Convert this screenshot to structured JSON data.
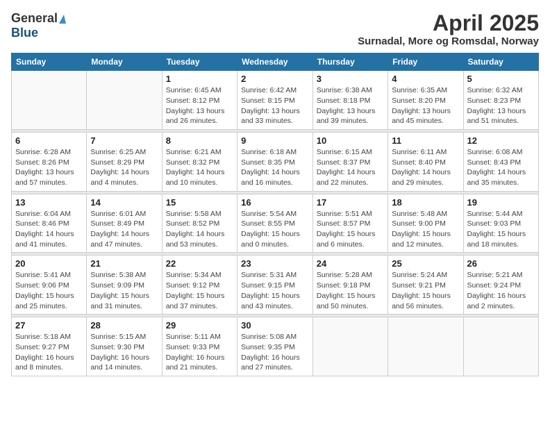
{
  "header": {
    "logo_general": "General",
    "logo_blue": "Blue",
    "month_title": "April 2025",
    "location": "Surnadal, More og Romsdal, Norway"
  },
  "weekdays": [
    "Sunday",
    "Monday",
    "Tuesday",
    "Wednesday",
    "Thursday",
    "Friday",
    "Saturday"
  ],
  "weeks": [
    [
      {
        "num": "",
        "info": ""
      },
      {
        "num": "",
        "info": ""
      },
      {
        "num": "1",
        "info": "Sunrise: 6:45 AM\nSunset: 8:12 PM\nDaylight: 13 hours and 26 minutes."
      },
      {
        "num": "2",
        "info": "Sunrise: 6:42 AM\nSunset: 8:15 PM\nDaylight: 13 hours and 33 minutes."
      },
      {
        "num": "3",
        "info": "Sunrise: 6:38 AM\nSunset: 8:18 PM\nDaylight: 13 hours and 39 minutes."
      },
      {
        "num": "4",
        "info": "Sunrise: 6:35 AM\nSunset: 8:20 PM\nDaylight: 13 hours and 45 minutes."
      },
      {
        "num": "5",
        "info": "Sunrise: 6:32 AM\nSunset: 8:23 PM\nDaylight: 13 hours and 51 minutes."
      }
    ],
    [
      {
        "num": "6",
        "info": "Sunrise: 6:28 AM\nSunset: 8:26 PM\nDaylight: 13 hours and 57 minutes."
      },
      {
        "num": "7",
        "info": "Sunrise: 6:25 AM\nSunset: 8:29 PM\nDaylight: 14 hours and 4 minutes."
      },
      {
        "num": "8",
        "info": "Sunrise: 6:21 AM\nSunset: 8:32 PM\nDaylight: 14 hours and 10 minutes."
      },
      {
        "num": "9",
        "info": "Sunrise: 6:18 AM\nSunset: 8:35 PM\nDaylight: 14 hours and 16 minutes."
      },
      {
        "num": "10",
        "info": "Sunrise: 6:15 AM\nSunset: 8:37 PM\nDaylight: 14 hours and 22 minutes."
      },
      {
        "num": "11",
        "info": "Sunrise: 6:11 AM\nSunset: 8:40 PM\nDaylight: 14 hours and 29 minutes."
      },
      {
        "num": "12",
        "info": "Sunrise: 6:08 AM\nSunset: 8:43 PM\nDaylight: 14 hours and 35 minutes."
      }
    ],
    [
      {
        "num": "13",
        "info": "Sunrise: 6:04 AM\nSunset: 8:46 PM\nDaylight: 14 hours and 41 minutes."
      },
      {
        "num": "14",
        "info": "Sunrise: 6:01 AM\nSunset: 8:49 PM\nDaylight: 14 hours and 47 minutes."
      },
      {
        "num": "15",
        "info": "Sunrise: 5:58 AM\nSunset: 8:52 PM\nDaylight: 14 hours and 53 minutes."
      },
      {
        "num": "16",
        "info": "Sunrise: 5:54 AM\nSunset: 8:55 PM\nDaylight: 15 hours and 0 minutes."
      },
      {
        "num": "17",
        "info": "Sunrise: 5:51 AM\nSunset: 8:57 PM\nDaylight: 15 hours and 6 minutes."
      },
      {
        "num": "18",
        "info": "Sunrise: 5:48 AM\nSunset: 9:00 PM\nDaylight: 15 hours and 12 minutes."
      },
      {
        "num": "19",
        "info": "Sunrise: 5:44 AM\nSunset: 9:03 PM\nDaylight: 15 hours and 18 minutes."
      }
    ],
    [
      {
        "num": "20",
        "info": "Sunrise: 5:41 AM\nSunset: 9:06 PM\nDaylight: 15 hours and 25 minutes."
      },
      {
        "num": "21",
        "info": "Sunrise: 5:38 AM\nSunset: 9:09 PM\nDaylight: 15 hours and 31 minutes."
      },
      {
        "num": "22",
        "info": "Sunrise: 5:34 AM\nSunset: 9:12 PM\nDaylight: 15 hours and 37 minutes."
      },
      {
        "num": "23",
        "info": "Sunrise: 5:31 AM\nSunset: 9:15 PM\nDaylight: 15 hours and 43 minutes."
      },
      {
        "num": "24",
        "info": "Sunrise: 5:28 AM\nSunset: 9:18 PM\nDaylight: 15 hours and 50 minutes."
      },
      {
        "num": "25",
        "info": "Sunrise: 5:24 AM\nSunset: 9:21 PM\nDaylight: 15 hours and 56 minutes."
      },
      {
        "num": "26",
        "info": "Sunrise: 5:21 AM\nSunset: 9:24 PM\nDaylight: 16 hours and 2 minutes."
      }
    ],
    [
      {
        "num": "27",
        "info": "Sunrise: 5:18 AM\nSunset: 9:27 PM\nDaylight: 16 hours and 8 minutes."
      },
      {
        "num": "28",
        "info": "Sunrise: 5:15 AM\nSunset: 9:30 PM\nDaylight: 16 hours and 14 minutes."
      },
      {
        "num": "29",
        "info": "Sunrise: 5:11 AM\nSunset: 9:33 PM\nDaylight: 16 hours and 21 minutes."
      },
      {
        "num": "30",
        "info": "Sunrise: 5:08 AM\nSunset: 9:35 PM\nDaylight: 16 hours and 27 minutes."
      },
      {
        "num": "",
        "info": ""
      },
      {
        "num": "",
        "info": ""
      },
      {
        "num": "",
        "info": ""
      }
    ]
  ]
}
